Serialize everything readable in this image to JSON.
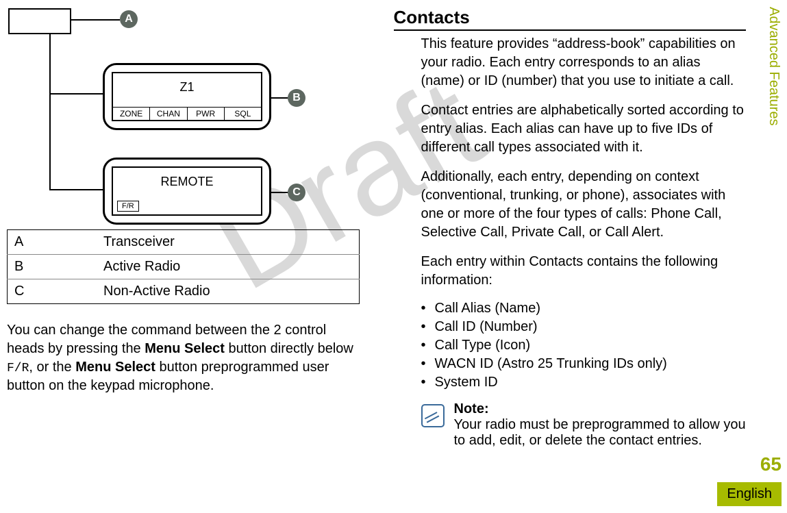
{
  "watermark": "Draft",
  "diagram": {
    "badges": {
      "a": "A",
      "b": "B",
      "c": "C"
    },
    "deviceB": {
      "title": "Z1",
      "softkeys": [
        "ZONE",
        "CHAN",
        "PWR",
        "SQL"
      ]
    },
    "deviceC": {
      "title": "REMOTE",
      "fr": "F/R"
    }
  },
  "legend": [
    {
      "key": "A",
      "label": "Transceiver"
    },
    {
      "key": "B",
      "label": "Active Radio"
    },
    {
      "key": "C",
      "label": "Non-Active Radio"
    }
  ],
  "left_para": {
    "pre": "You can change the command between the 2 control heads by pressing the ",
    "bold1": "Menu Select",
    "mid1": " button directly below ",
    "mono": "F/R",
    "mid2": ", or the ",
    "bold2": "Menu Select",
    "post": " button preprogrammed user button on the keypad microphone."
  },
  "right": {
    "heading": "Contacts",
    "p1": "This feature provides “address-book” capabilities on your radio. Each entry corresponds to an alias (name) or ID (number) that you use to initiate a call.",
    "p2": "Contact entries are alphabetically sorted according to entry alias. Each alias can have up to five IDs of different call types associated with it.",
    "p3": "Additionally, each entry, depending on context (conventional, trunking, or phone), associates with one or more of the four types of calls: Phone Call, Selective Call, Private Call, or Call Alert.",
    "p4": "Each entry within Contacts contains the following information:",
    "bullets": [
      "Call Alias (Name)",
      "Call ID (Number)",
      "Call Type (Icon)",
      "WACN ID (Astro 25 Trunking IDs only)",
      "System ID"
    ],
    "note_label": "Note:",
    "note_body": "Your radio must be preprogrammed to allow you to add, edit, or delete the contact entries."
  },
  "margin": {
    "section": "Advanced Features",
    "page": "65",
    "lang": "English"
  }
}
